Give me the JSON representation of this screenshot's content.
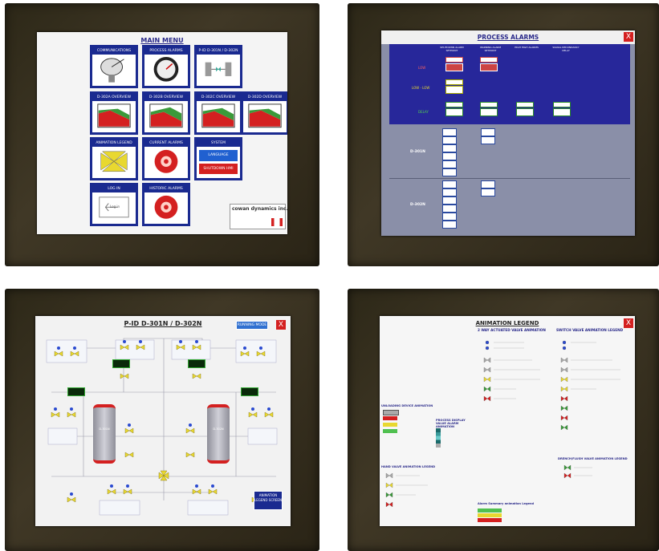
{
  "screens": {
    "main_menu": {
      "title": "MAIN MENU",
      "tiles": [
        {
          "label": "COMMUNICATIONS",
          "icon": "satellite-dish-icon"
        },
        {
          "label": "PROCESS ALARMS",
          "icon": "pressure-gauge-icon"
        },
        {
          "label": "P-ID D-301N / D-302N",
          "icon": "pid-schematic-icon"
        },
        {
          "label": "D-302A OVERVIEW",
          "icon": "tank-level-icon"
        },
        {
          "label": "D-302B OVERVIEW",
          "icon": "tank-level-icon"
        },
        {
          "label": "D-302C OVERVIEW",
          "icon": "tank-level-icon"
        },
        {
          "label": "D-302D OVERVIEW",
          "icon": "tank-level-icon"
        },
        {
          "label": "ANIMATION LEGEND",
          "icon": "valve-legend-icon"
        },
        {
          "label": "CURRENT ALARMS",
          "icon": "alarm-bell-icon"
        },
        {
          "label": "SYSTEM",
          "icon": "system-icon"
        },
        {
          "label": "LOG IN",
          "icon": "login-icon"
        },
        {
          "label": "HISTORIC ALARMS",
          "icon": "alarm-bell-icon"
        }
      ],
      "language_button": "LANGUAGE",
      "shutdown_button": "SHUTDOWN HMI",
      "login_text": "Log in",
      "brand": "cowan dynamics inc."
    },
    "process_alarms": {
      "title": "PROCESS ALARMS",
      "close": "X",
      "columns": [
        "SHUTDOWN ALARM SETPOINT",
        "WARNING ALARM SETPOINT",
        "HIGH HIGH ALARMS",
        "SIGNAL REDUNDANCY DELAY"
      ],
      "rows": [
        "LOW",
        "LOW - LOW",
        "DELAY"
      ],
      "sections": [
        "D-301N",
        "D-302N"
      ]
    },
    "pid": {
      "title": "P-ID  D-301N / D-302N",
      "mode_button": "RUNNING MODE",
      "close": "X",
      "legend_button": "ANIMATION LEGEND SCREEN",
      "tanks": [
        "D-301N",
        "D-302N"
      ]
    },
    "animation_legend": {
      "title": "ANIMATION LEGEND",
      "sections": [
        "2 WAY ACTUATED VALVE ANIMATION",
        "SWITCH VALVE ANIMATION LEGEND",
        "UNLOADING DEVICE ANIMATION",
        "PROCESS DISPLAY VALUE ALARM ANIMATION",
        "HAND VALVE ANIMATION LEGEND",
        "DRENCH/FLUSH VALVE ANIMATION LEGEND",
        "Alarm Summary animation Legend"
      ]
    }
  },
  "colors": {
    "menu_blue": "#1a2a90",
    "alarm_blue": "#27279a",
    "alarm_gray": "#8a8fa8",
    "red": "#d42020",
    "green": "#3a9a3a",
    "yellow": "#e8d830"
  }
}
